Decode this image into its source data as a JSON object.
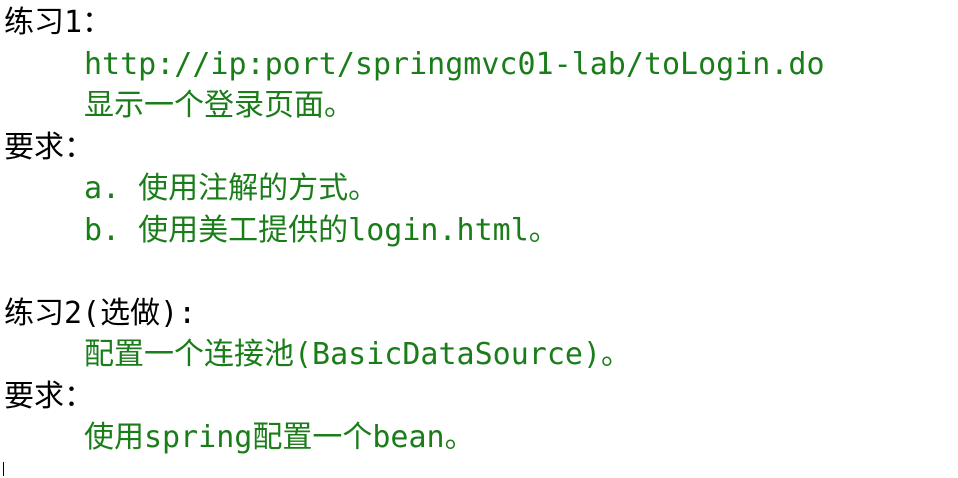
{
  "exercise1": {
    "title": "练习1：",
    "url": "http://ip:port/springmvc01-lab/toLogin.do",
    "description": "显示一个登录页面。",
    "requirements_label": "要求：",
    "requirement_a": "a. 使用注解的方式。",
    "requirement_b": "b. 使用美工提供的login.html。"
  },
  "exercise2": {
    "title": "练习2(选做):",
    "description": "配置一个连接池(BasicDataSource)。",
    "requirements_label": "要求：",
    "requirement": "使用spring配置一个bean。"
  },
  "colors": {
    "heading": "#000000",
    "body": "#1a7d1a"
  }
}
